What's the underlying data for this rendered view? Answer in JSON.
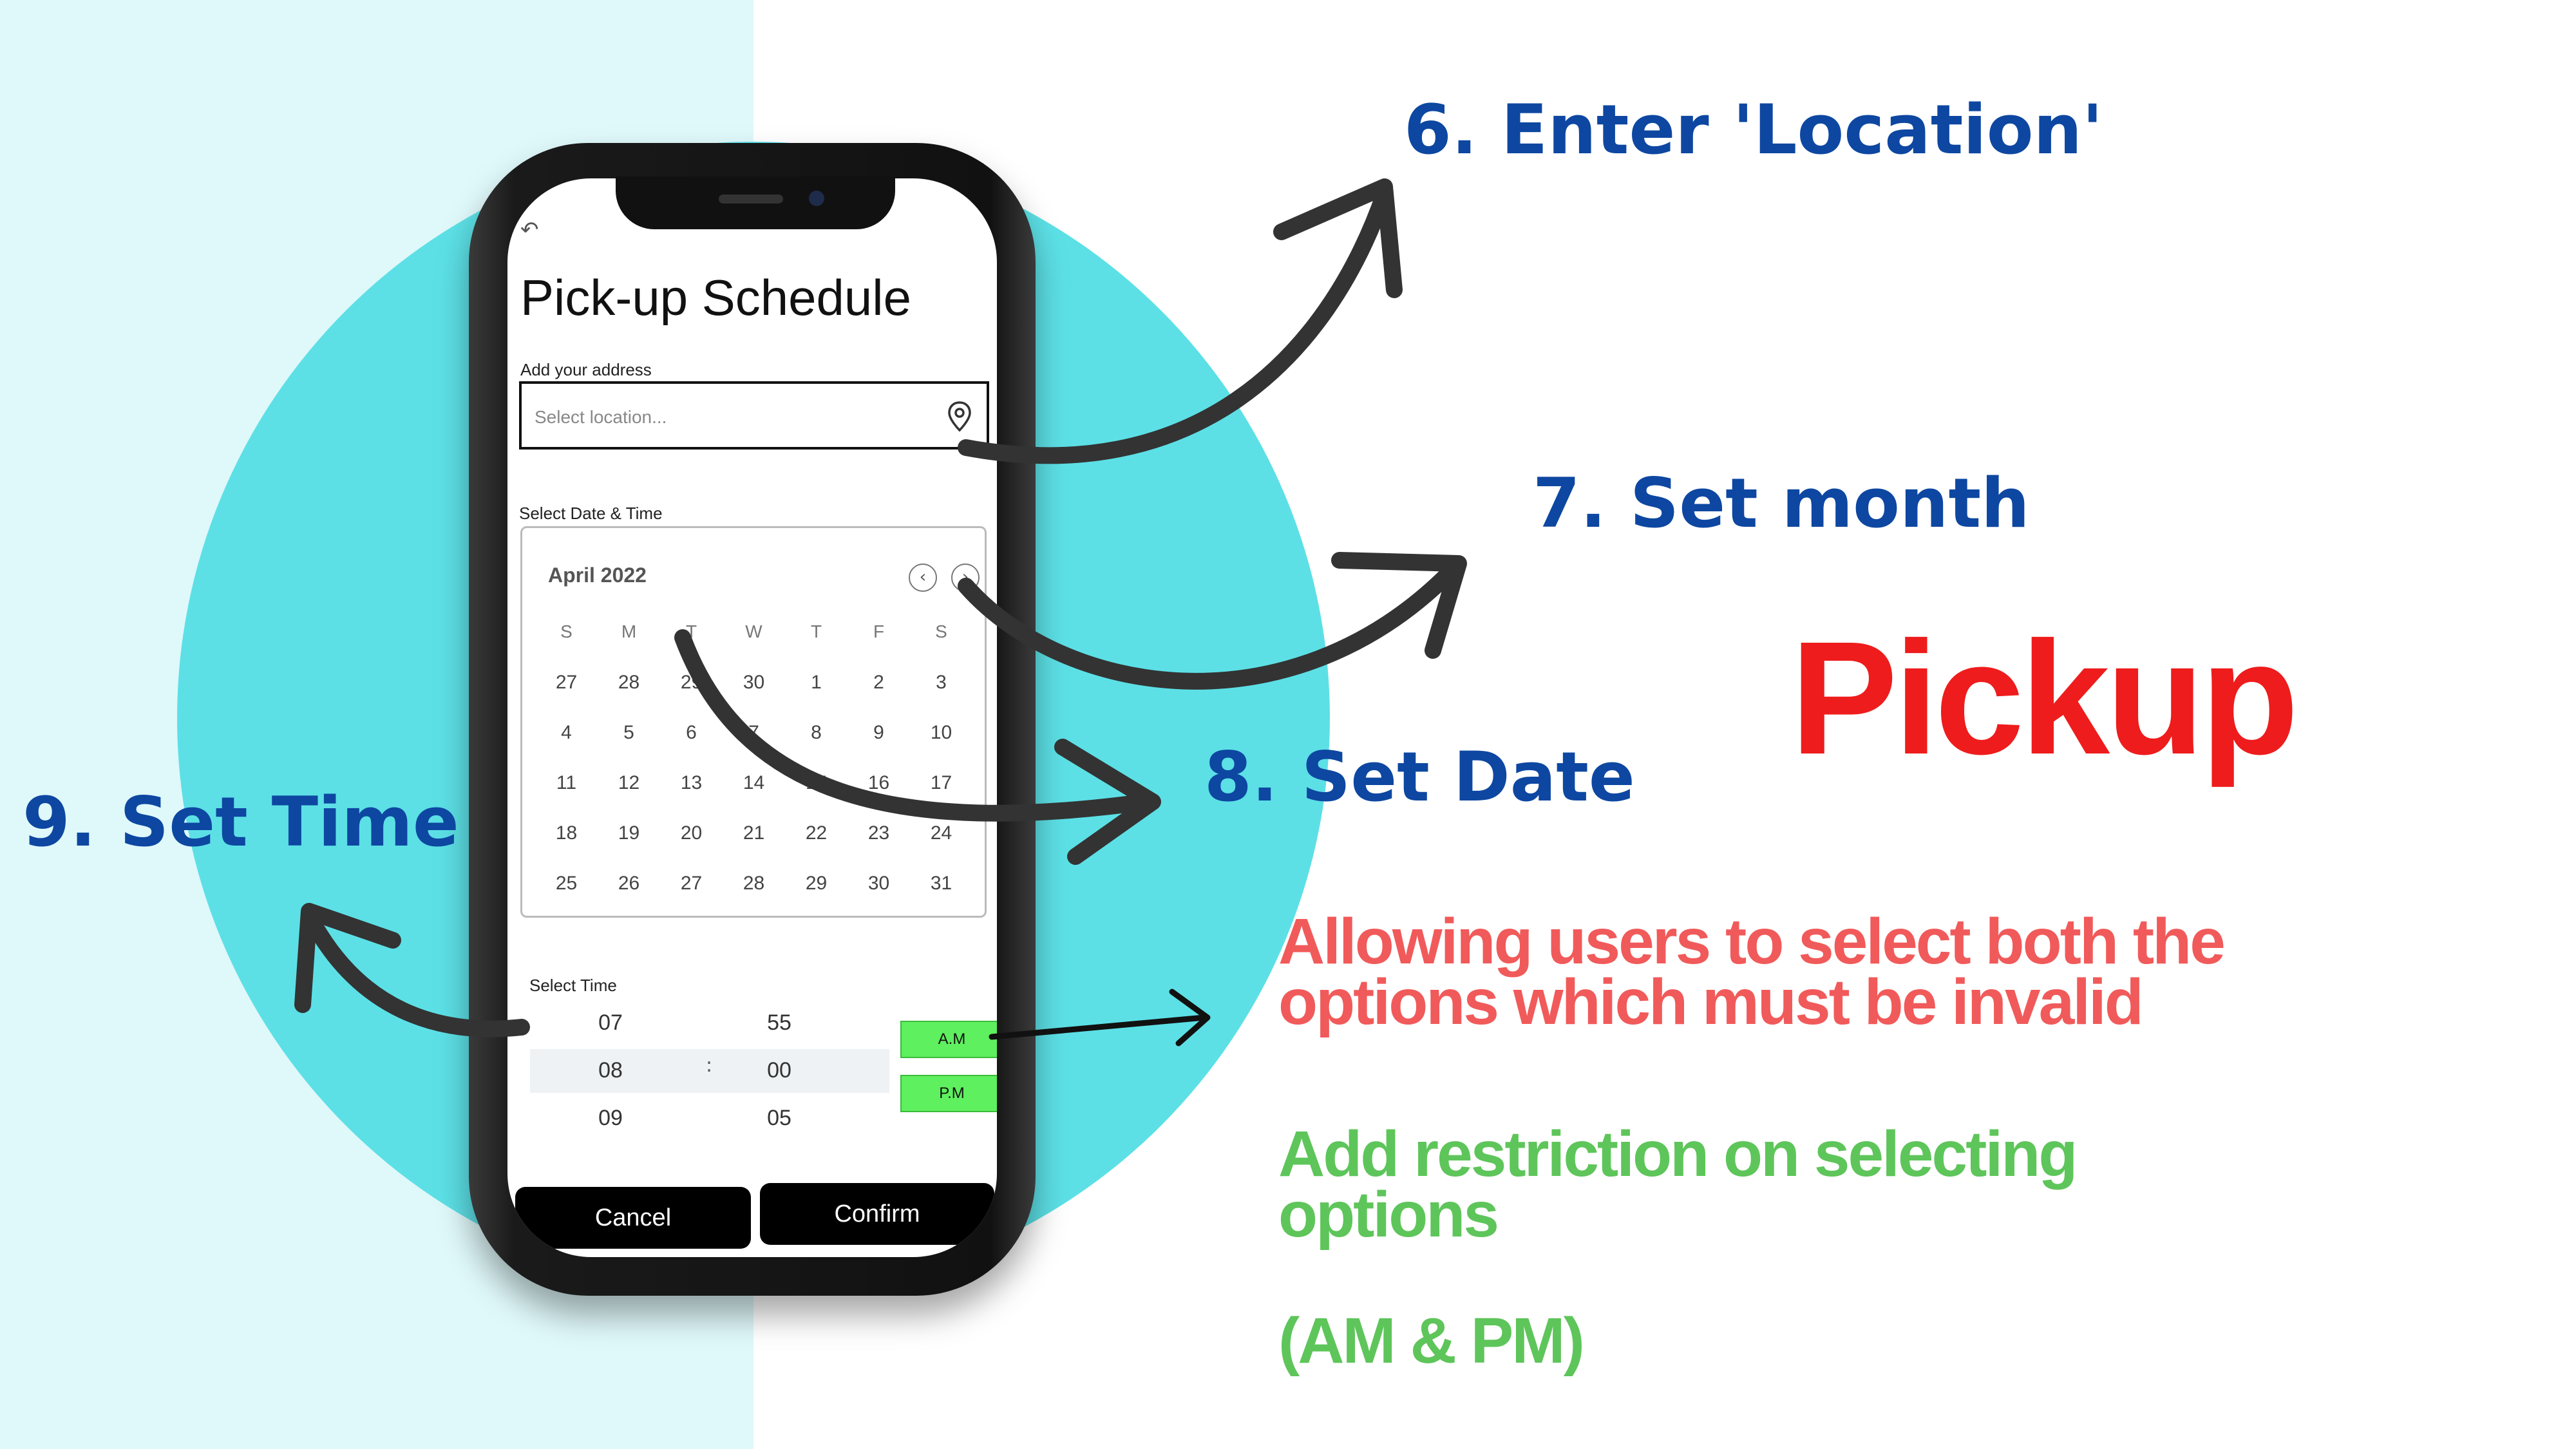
{
  "phone_app": {
    "back_icon": "↶",
    "title": "Pick-up Schedule",
    "address_label": "Add your address",
    "location_placeholder": "Select location...",
    "datetime_label": "Select Date & Time",
    "calendar": {
      "month": "April 2022",
      "prev_icon": "‹",
      "next_icon": "›",
      "weekdays": [
        "S",
        "M",
        "T",
        "W",
        "T",
        "F",
        "S"
      ],
      "weeks": [
        [
          "27",
          "28",
          "29",
          "30",
          "1",
          "2",
          "3"
        ],
        [
          "4",
          "5",
          "6",
          "7",
          "8",
          "9",
          "10"
        ],
        [
          "11",
          "12",
          "13",
          "14",
          "15",
          "16",
          "17"
        ],
        [
          "18",
          "19",
          "20",
          "21",
          "22",
          "23",
          "24"
        ],
        [
          "25",
          "26",
          "27",
          "28",
          "29",
          "30",
          "31"
        ]
      ]
    },
    "time_label": "Select Time",
    "hours": [
      "07",
      "08",
      "09"
    ],
    "minutes": [
      "55",
      "00",
      "05"
    ],
    "colon": ":",
    "am_label": "A.M",
    "pm_label": "P.M",
    "cancel_label": "Cancel",
    "confirm_label": "Confirm"
  },
  "annotations": {
    "step6": "6. Enter 'Location'",
    "step7": "7. Set month",
    "step8": "8. Set Date",
    "step9": "9. Set Time",
    "heading": "Pickup",
    "issue": "Allowing users to select both the options which must be invalid",
    "fix": "Add restriction on selecting options",
    "fix_detail": "(AM & PM)"
  },
  "colors": {
    "background_left": "#dff8fa",
    "circle": "#5ce0e6",
    "step_text": "#0d47a1",
    "heading": "#ee1c1c",
    "issue_text": "#f15a5a",
    "fix_text": "#5ec55a",
    "ampm_button": "#5ef05e"
  }
}
